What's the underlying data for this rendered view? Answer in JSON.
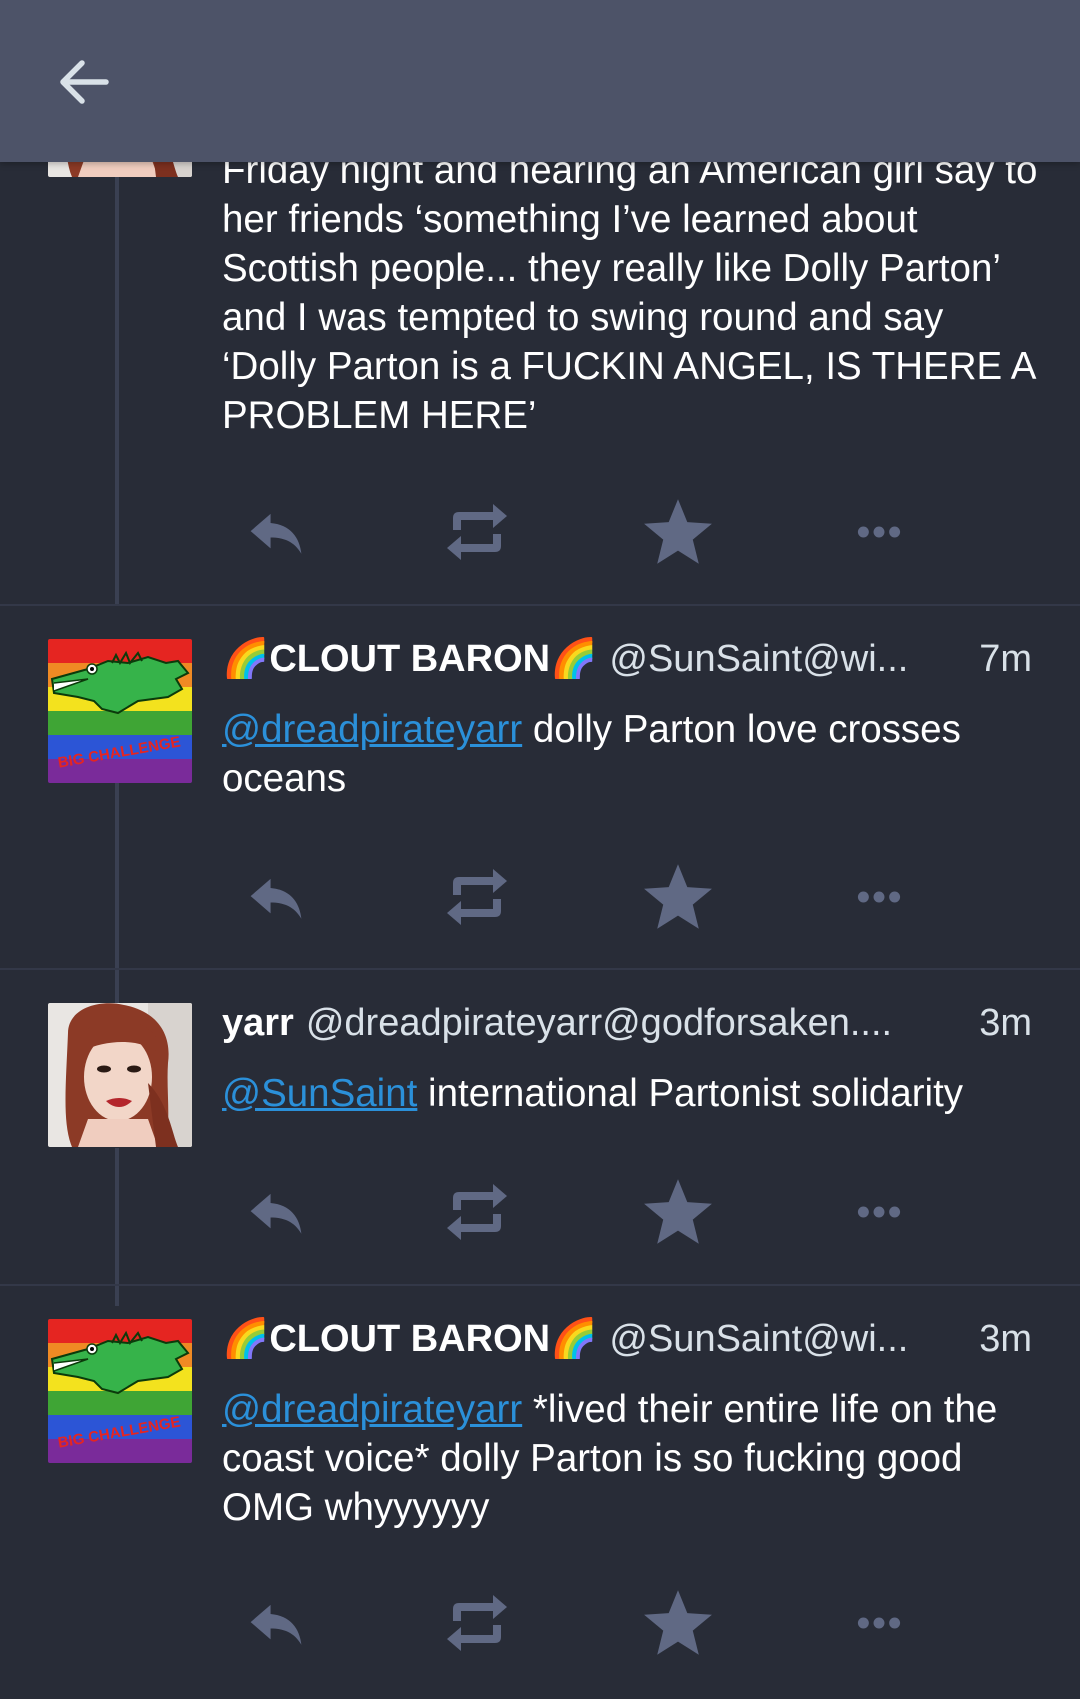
{
  "colors": {
    "topbar": "#4d5368",
    "background": "#282c37",
    "mention": "#2b90d9",
    "icon": "#606984"
  },
  "topbar": {
    "back_icon": "arrow-left-icon"
  },
  "posts": [
    {
      "content": "Friday night and hearing an American girl say to her friends ‘something I’ve learned about Scottish people... they really like Dolly Parton’ and I was tempted to swing round and say ‘Dolly Parton is a FUCKIN ANGEL, IS THERE A PROBLEM HERE’"
    },
    {
      "display_name": "🌈CLOUT BARON🌈",
      "account": "@SunSaint@wi...",
      "time": "7m",
      "mention": "@dreadpirateyarr",
      "content": " dolly Parton love crosses oceans"
    },
    {
      "display_name": "yarr",
      "account": "@dreadpirateyarr@godforsaken....",
      "time": "3m",
      "mention": "@SunSaint",
      "content": " international Partonist solidarity"
    },
    {
      "display_name": "🌈CLOUT BARON🌈",
      "account": "@SunSaint@wi...",
      "time": "3m",
      "mention": "@dreadpirateyarr",
      "content": " *lived their entire life on the coast voice* dolly Parton is so fucking good OMG whyyyyyy"
    }
  ],
  "action_icons": [
    "reply-icon",
    "boost-icon",
    "favourite-icon",
    "more-icon"
  ],
  "avatar_text": {
    "clout": "BIG CHALLENGE"
  }
}
